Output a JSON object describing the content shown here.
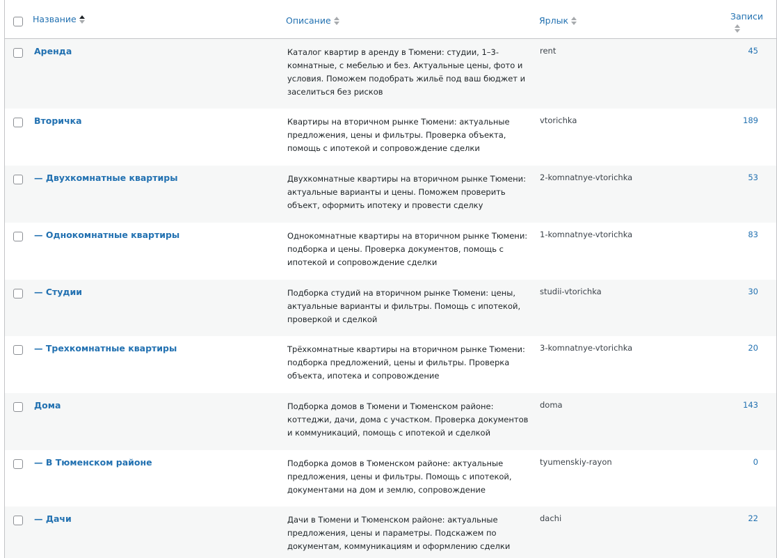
{
  "header": {
    "name": "Название",
    "description": "Описание",
    "slug": "Ярлык",
    "count": "Записи"
  },
  "rows": [
    {
      "name": "Аренда",
      "description": "Каталог квартир в аренду в Тюмени: студии, 1–3-комнатные, с мебелью и без. Актуальные цены, фото и условия. Поможем подобрать жильё под ваш бюджет и заселиться без рисков",
      "slug": "rent",
      "count": "45"
    },
    {
      "name": "Вторичка",
      "description": "Квартиры на вторичном рынке Тюмени: актуальные предложения, цены и фильтры. Проверка объекта, помощь с ипотекой и сопровождение сделки",
      "slug": "vtorichka",
      "count": "189"
    },
    {
      "name": "— Двухкомнатные квартиры",
      "description": "Двухкомнатные квартиры на вторичном рынке Тюмени: актуальные варианты и цены. Поможем проверить объект, оформить ипотеку и провести сделку",
      "slug": "2-komnatnye-vtorichka",
      "count": "53"
    },
    {
      "name": "— Однокомнатные квартиры",
      "description": "Однокомнатные квартиры на вторичном рынке Тюмени: подборка и цены. Проверка документов, помощь с ипотекой и сопровождение сделки",
      "slug": "1-komnatnye-vtorichka",
      "count": "83"
    },
    {
      "name": "— Студии",
      "description": "Подборка студий на вторичном рынке Тюмени: цены, актуальные варианты и фильтры. Помощь с ипотекой, проверкой и сделкой",
      "slug": "studii-vtorichka",
      "count": "30"
    },
    {
      "name": "— Трехкомнатные квартиры",
      "description": "Трёхкомнатные квартиры на вторичном рынке Тюмени: подборка предложений, цены и фильтры. Проверка объекта, ипотека и сопровождение",
      "slug": "3-komnatnye-vtorichka",
      "count": "20"
    },
    {
      "name": "Дома",
      "description": "Подборка домов в Тюмени и Тюменском районе: коттеджи, дачи, дома с участком. Проверка документов и коммуникаций, помощь с ипотекой и сделкой",
      "slug": "doma",
      "count": "143"
    },
    {
      "name": "— В Тюменском районе",
      "description": "Подборка домов в Тюменском районе: актуальные предложения, цены и фильтры. Помощь с ипотекой, документами на дом и землю, сопровождение",
      "slug": "tyumenskiy-rayon",
      "count": "0"
    },
    {
      "name": "— Дачи",
      "description": "Дачи в Тюмени и Тюменском районе: актуальные предложения, цены и параметры. Подскажем по документам, коммуникациям и оформлению сделки",
      "slug": "dachi",
      "count": "22"
    }
  ]
}
